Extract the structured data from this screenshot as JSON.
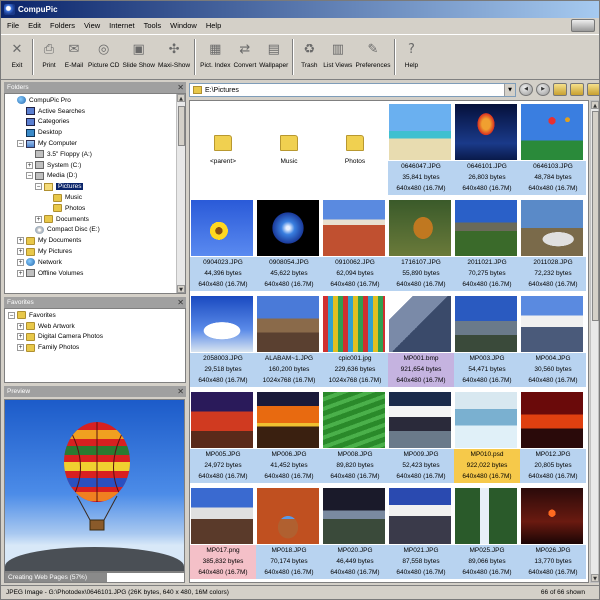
{
  "window": {
    "title": "CompuPic"
  },
  "menu": [
    "File",
    "Edit",
    "Folders",
    "View",
    "Internet",
    "Tools",
    "Window",
    "Help"
  ],
  "toolbar": [
    {
      "label": "Exit",
      "icon": "exit-icon",
      "glyph": "✕"
    },
    {
      "label": "Print",
      "icon": "print-icon",
      "glyph": "⎙"
    },
    {
      "label": "E-Mail",
      "icon": "email-icon",
      "glyph": "✉"
    },
    {
      "label": "Picture CD",
      "icon": "picture-cd-icon",
      "glyph": "◎"
    },
    {
      "label": "Slide Show",
      "icon": "slide-show-icon",
      "glyph": "▣"
    },
    {
      "label": "Maxi-Show",
      "icon": "maxi-show-icon",
      "glyph": "✣"
    },
    {
      "label": "Pict. Index",
      "icon": "pict-index-icon",
      "glyph": "▦"
    },
    {
      "label": "Convert",
      "icon": "convert-icon",
      "glyph": "⇄"
    },
    {
      "label": "Wallpaper",
      "icon": "wallpaper-icon",
      "glyph": "▤"
    },
    {
      "label": "Trash",
      "icon": "trash-icon",
      "glyph": "♻"
    },
    {
      "label": "List Views",
      "icon": "list-views-icon",
      "glyph": "▥"
    },
    {
      "label": "Preferences",
      "icon": "preferences-icon",
      "glyph": "✎"
    },
    {
      "label": "Help",
      "icon": "help-icon",
      "glyph": "?"
    }
  ],
  "folders_pane": {
    "title": "Folders",
    "tree": [
      {
        "label": "CompuPic Pro",
        "depth": 0,
        "icon": "ico-globe",
        "exp": ""
      },
      {
        "label": "Active Searches",
        "depth": 1,
        "icon": "ico-blue",
        "exp": ""
      },
      {
        "label": "Categories",
        "depth": 1,
        "icon": "ico-blue",
        "exp": ""
      },
      {
        "label": "Desktop",
        "depth": 1,
        "icon": "ico-desk",
        "exp": ""
      },
      {
        "label": "My Computer",
        "depth": 1,
        "icon": "ico-pc",
        "exp": "−"
      },
      {
        "label": "3.5\" Floppy (A:)",
        "depth": 2,
        "icon": "ico-disk",
        "exp": ""
      },
      {
        "label": "System (C:)",
        "depth": 2,
        "icon": "ico-disk",
        "exp": "+"
      },
      {
        "label": "Media (D:)",
        "depth": 2,
        "icon": "ico-disk",
        "exp": "−"
      },
      {
        "label": "Pictures",
        "depth": 3,
        "icon": "ico-folder-open",
        "exp": "−",
        "selected": true
      },
      {
        "label": "Music",
        "depth": 4,
        "icon": "ico-folder",
        "exp": ""
      },
      {
        "label": "Photos",
        "depth": 4,
        "icon": "ico-folder",
        "exp": ""
      },
      {
        "label": "Documents",
        "depth": 3,
        "icon": "ico-folder",
        "exp": "+"
      },
      {
        "label": "Compact Disc (E:)",
        "depth": 2,
        "icon": "ico-cd",
        "exp": ""
      },
      {
        "label": "My Documents",
        "depth": 1,
        "icon": "ico-folder",
        "exp": "+"
      },
      {
        "label": "My Pictures",
        "depth": 1,
        "icon": "ico-folder",
        "exp": "+"
      },
      {
        "label": "Network",
        "depth": 1,
        "icon": "ico-globe",
        "exp": "+"
      },
      {
        "label": "Offline Volumes",
        "depth": 1,
        "icon": "ico-disk",
        "exp": "+"
      }
    ]
  },
  "favorites_pane": {
    "title": "Favorites",
    "tree": [
      {
        "label": "Favorites",
        "depth": 0,
        "exp": "−"
      },
      {
        "label": "Web Artwork",
        "depth": 1,
        "exp": "+"
      },
      {
        "label": "Digital Camera Photos",
        "depth": 1,
        "exp": "+"
      },
      {
        "label": "Family Photos",
        "depth": 1,
        "exp": "+"
      }
    ]
  },
  "preview_pane": {
    "title": "Preview"
  },
  "progress": {
    "label": "Creating Web Pages (57%)",
    "fraction": 0.57
  },
  "path": {
    "value": "E:\\Pictures"
  },
  "folders": [
    {
      "name": "<parent>"
    },
    {
      "name": "Music"
    },
    {
      "name": "Photos"
    }
  ],
  "files": [
    {
      "name": "0646047.JPG",
      "size": "35,841 bytes",
      "dims": "640x480 (16.7M)",
      "thumb": "t-beach",
      "tag": "blue"
    },
    {
      "name": "0646101.JPG",
      "size": "26,803 bytes",
      "dims": "640x480 (16.7M)",
      "thumb": "t-balloon-dark",
      "tag": "blue"
    },
    {
      "name": "0646103.JPG",
      "size": "48,784 bytes",
      "dims": "640x480 (16.7M)",
      "thumb": "t-balloon-sky",
      "tag": "blue"
    },
    {
      "name": "0904023.JPG",
      "size": "44,396 bytes",
      "dims": "640x480 (16.7M)",
      "thumb": "t-flower",
      "tag": "blue"
    },
    {
      "name": "0908054.JPG",
      "size": "45,622 bytes",
      "dims": "640x480 (16.7M)",
      "thumb": "t-earth",
      "tag": "blue"
    },
    {
      "name": "0910062.JPG",
      "size": "62,094 bytes",
      "dims": "640x480 (16.7M)",
      "thumb": "t-desert",
      "tag": "blue"
    },
    {
      "name": "1716107.JPG",
      "size": "55,890 bytes",
      "dims": "640x480 (16.7M)",
      "thumb": "t-lion",
      "tag": "blue"
    },
    {
      "name": "2011021.JPG",
      "size": "70,275 bytes",
      "dims": "640x480 (16.7M)",
      "thumb": "t-church",
      "tag": "blue"
    },
    {
      "name": "2011028.JPG",
      "size": "72,232 bytes",
      "dims": "640x480 (16.7M)",
      "thumb": "t-truck",
      "tag": "blue"
    },
    {
      "name": "2058003.JPG",
      "size": "29,518 bytes",
      "dims": "640x480 (16.7M)",
      "thumb": "t-clouds",
      "tag": "blue"
    },
    {
      "name": "ALABAM~1.JPG",
      "size": "160,200 bytes",
      "dims": "1024x768 (16.7M)",
      "thumb": "t-alabam",
      "tag": "blue"
    },
    {
      "name": "cpic001.jpg",
      "size": "229,636 bytes",
      "dims": "1024x768 (16.7M)",
      "thumb": "t-cpic",
      "tag": "blue"
    },
    {
      "name": "MP001.bmp",
      "size": "921,654 bytes",
      "dims": "640x480 (16.7M)",
      "thumb": "t-mountain",
      "tag": "purple"
    },
    {
      "name": "MP003.JPG",
      "size": "54,471 bytes",
      "dims": "640x480 (16.7M)",
      "thumb": "t-mountain2",
      "tag": "blue"
    },
    {
      "name": "MP004.JPG",
      "size": "30,560 bytes",
      "dims": "640x480 (16.7M)",
      "thumb": "t-snowpeak",
      "tag": "blue"
    },
    {
      "name": "MP005.JPG",
      "size": "24,972 bytes",
      "dims": "640x480 (16.7M)",
      "thumb": "t-ayers",
      "tag": "blue"
    },
    {
      "name": "MP006.JPG",
      "size": "41,452 bytes",
      "dims": "640x480 (16.7M)",
      "thumb": "t-sunset",
      "tag": "blue"
    },
    {
      "name": "MP008.JPG",
      "size": "89,820 bytes",
      "dims": "640x480 (16.7M)",
      "thumb": "t-terrace",
      "tag": "blue"
    },
    {
      "name": "MP009.JPG",
      "size": "52,423 bytes",
      "dims": "640x480 (16.7M)",
      "thumb": "t-snowrock",
      "tag": "blue"
    },
    {
      "name": "MP010.psd",
      "size": "922,022 bytes",
      "dims": "640x480 (16.7M)",
      "thumb": "t-ice",
      "tag": "yellow"
    },
    {
      "name": "MP012.JPG",
      "size": "20,805 bytes",
      "dims": "640x480 (16.7M)",
      "thumb": "t-redsky",
      "tag": "blue"
    },
    {
      "name": "MP017.png",
      "size": "385,832 bytes",
      "dims": "640x480 (16.7M)",
      "thumb": "t-mount3",
      "tag": "pink"
    },
    {
      "name": "MP018.JPG",
      "size": "70,174 bytes",
      "dims": "640x480 (16.7M)",
      "thumb": "t-arch",
      "tag": "blue"
    },
    {
      "name": "MP020.JPG",
      "size": "46,449 bytes",
      "dims": "640x480 (16.7M)",
      "thumb": "t-storm",
      "tag": "blue"
    },
    {
      "name": "MP021.JPG",
      "size": "87,558 bytes",
      "dims": "640x480 (16.7M)",
      "thumb": "t-pyrenees",
      "tag": "blue"
    },
    {
      "name": "MP025.JPG",
      "size": "89,066 bytes",
      "dims": "640x480 (16.7M)",
      "thumb": "t-waterfall",
      "tag": "blue"
    },
    {
      "name": "MP026.JPG",
      "size": "13,770 bytes",
      "dims": "640x480 (16.7M)",
      "thumb": "t-nightsun",
      "tag": "blue"
    }
  ],
  "status": {
    "left": "JPEG Image - G:\\Photodex\\0646101.JPG  (26K bytes, 640 x 480, 16M colors)",
    "right": "66 of 66 shown"
  },
  "colors": {
    "title_bar": "#0a246a",
    "selection": "#0a246a",
    "caption_default": "#b8d3f0",
    "caption_bmp": "#c5b3e0",
    "caption_psd": "#f6c94a",
    "caption_png": "#f4c0c8"
  }
}
